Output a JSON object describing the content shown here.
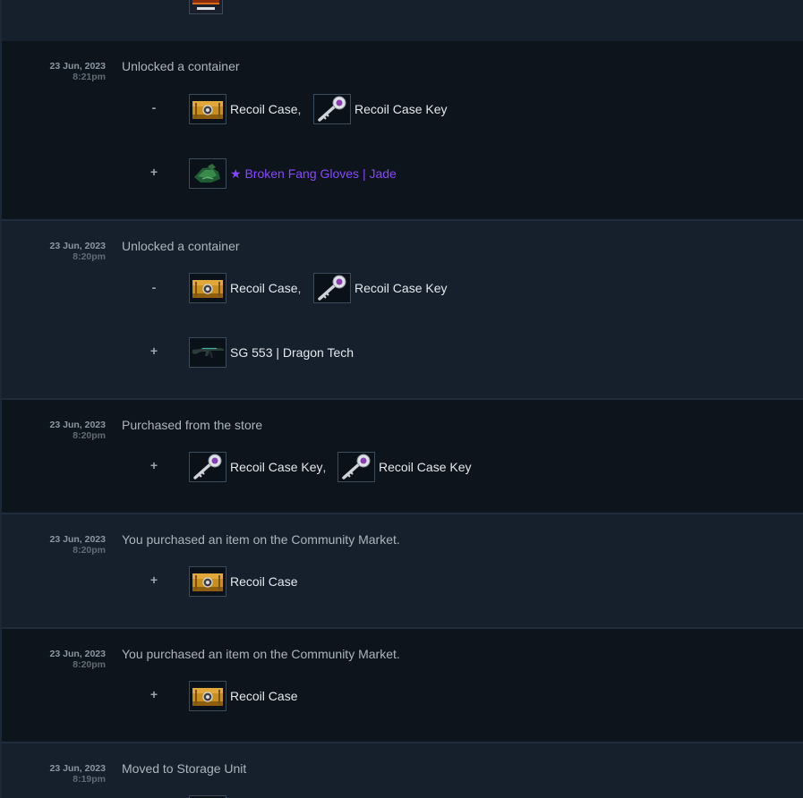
{
  "entries": [
    {
      "date": "23 Jun, 2023",
      "time": "8:21pm",
      "description": "Unlocked a container",
      "sign_minus": "-",
      "sign_plus": "+",
      "removed": [
        {
          "name": "Recoil Case",
          "icon": "recoil-case-icon"
        },
        {
          "name": "Recoil Case Key",
          "icon": "recoil-case-key-icon"
        }
      ],
      "added": [
        {
          "name": "★ Broken Fang Gloves | Jade",
          "icon": "broken-fang-gloves-icon",
          "color": "#8847ff"
        }
      ]
    },
    {
      "date": "23 Jun, 2023",
      "time": "8:20pm",
      "description": "Unlocked a container",
      "sign_minus": "-",
      "sign_plus": "+",
      "removed": [
        {
          "name": "Recoil Case",
          "icon": "recoil-case-icon"
        },
        {
          "name": "Recoil Case Key",
          "icon": "recoil-case-key-icon"
        }
      ],
      "added": [
        {
          "name": "SG 553 | Dragon Tech",
          "icon": "sg553-rifle-icon"
        }
      ]
    },
    {
      "date": "23 Jun, 2023",
      "time": "8:20pm",
      "description": "Purchased from the store",
      "sign_plus": "+",
      "added": [
        {
          "name": "Recoil Case Key",
          "icon": "recoil-case-key-icon"
        },
        {
          "name": "Recoil Case Key",
          "icon": "recoil-case-key-icon"
        }
      ]
    },
    {
      "date": "23 Jun, 2023",
      "time": "8:20pm",
      "description": "You purchased an item on the Community Market.",
      "sign_plus": "+",
      "added": [
        {
          "name": "Recoil Case",
          "icon": "recoil-case-icon"
        }
      ]
    },
    {
      "date": "23 Jun, 2023",
      "time": "8:20pm",
      "description": "You purchased an item on the Community Market.",
      "sign_plus": "+",
      "added": [
        {
          "name": "Recoil Case",
          "icon": "recoil-case-icon"
        }
      ]
    },
    {
      "date": "23 Jun, 2023",
      "time": "8:19pm",
      "description": "Moved to Storage Unit"
    }
  ],
  "separator": ",",
  "colors": {
    "background": "#1b2838",
    "row_dark": "#0e141b",
    "row_light": "#16202d",
    "covert": "#8847ff"
  }
}
